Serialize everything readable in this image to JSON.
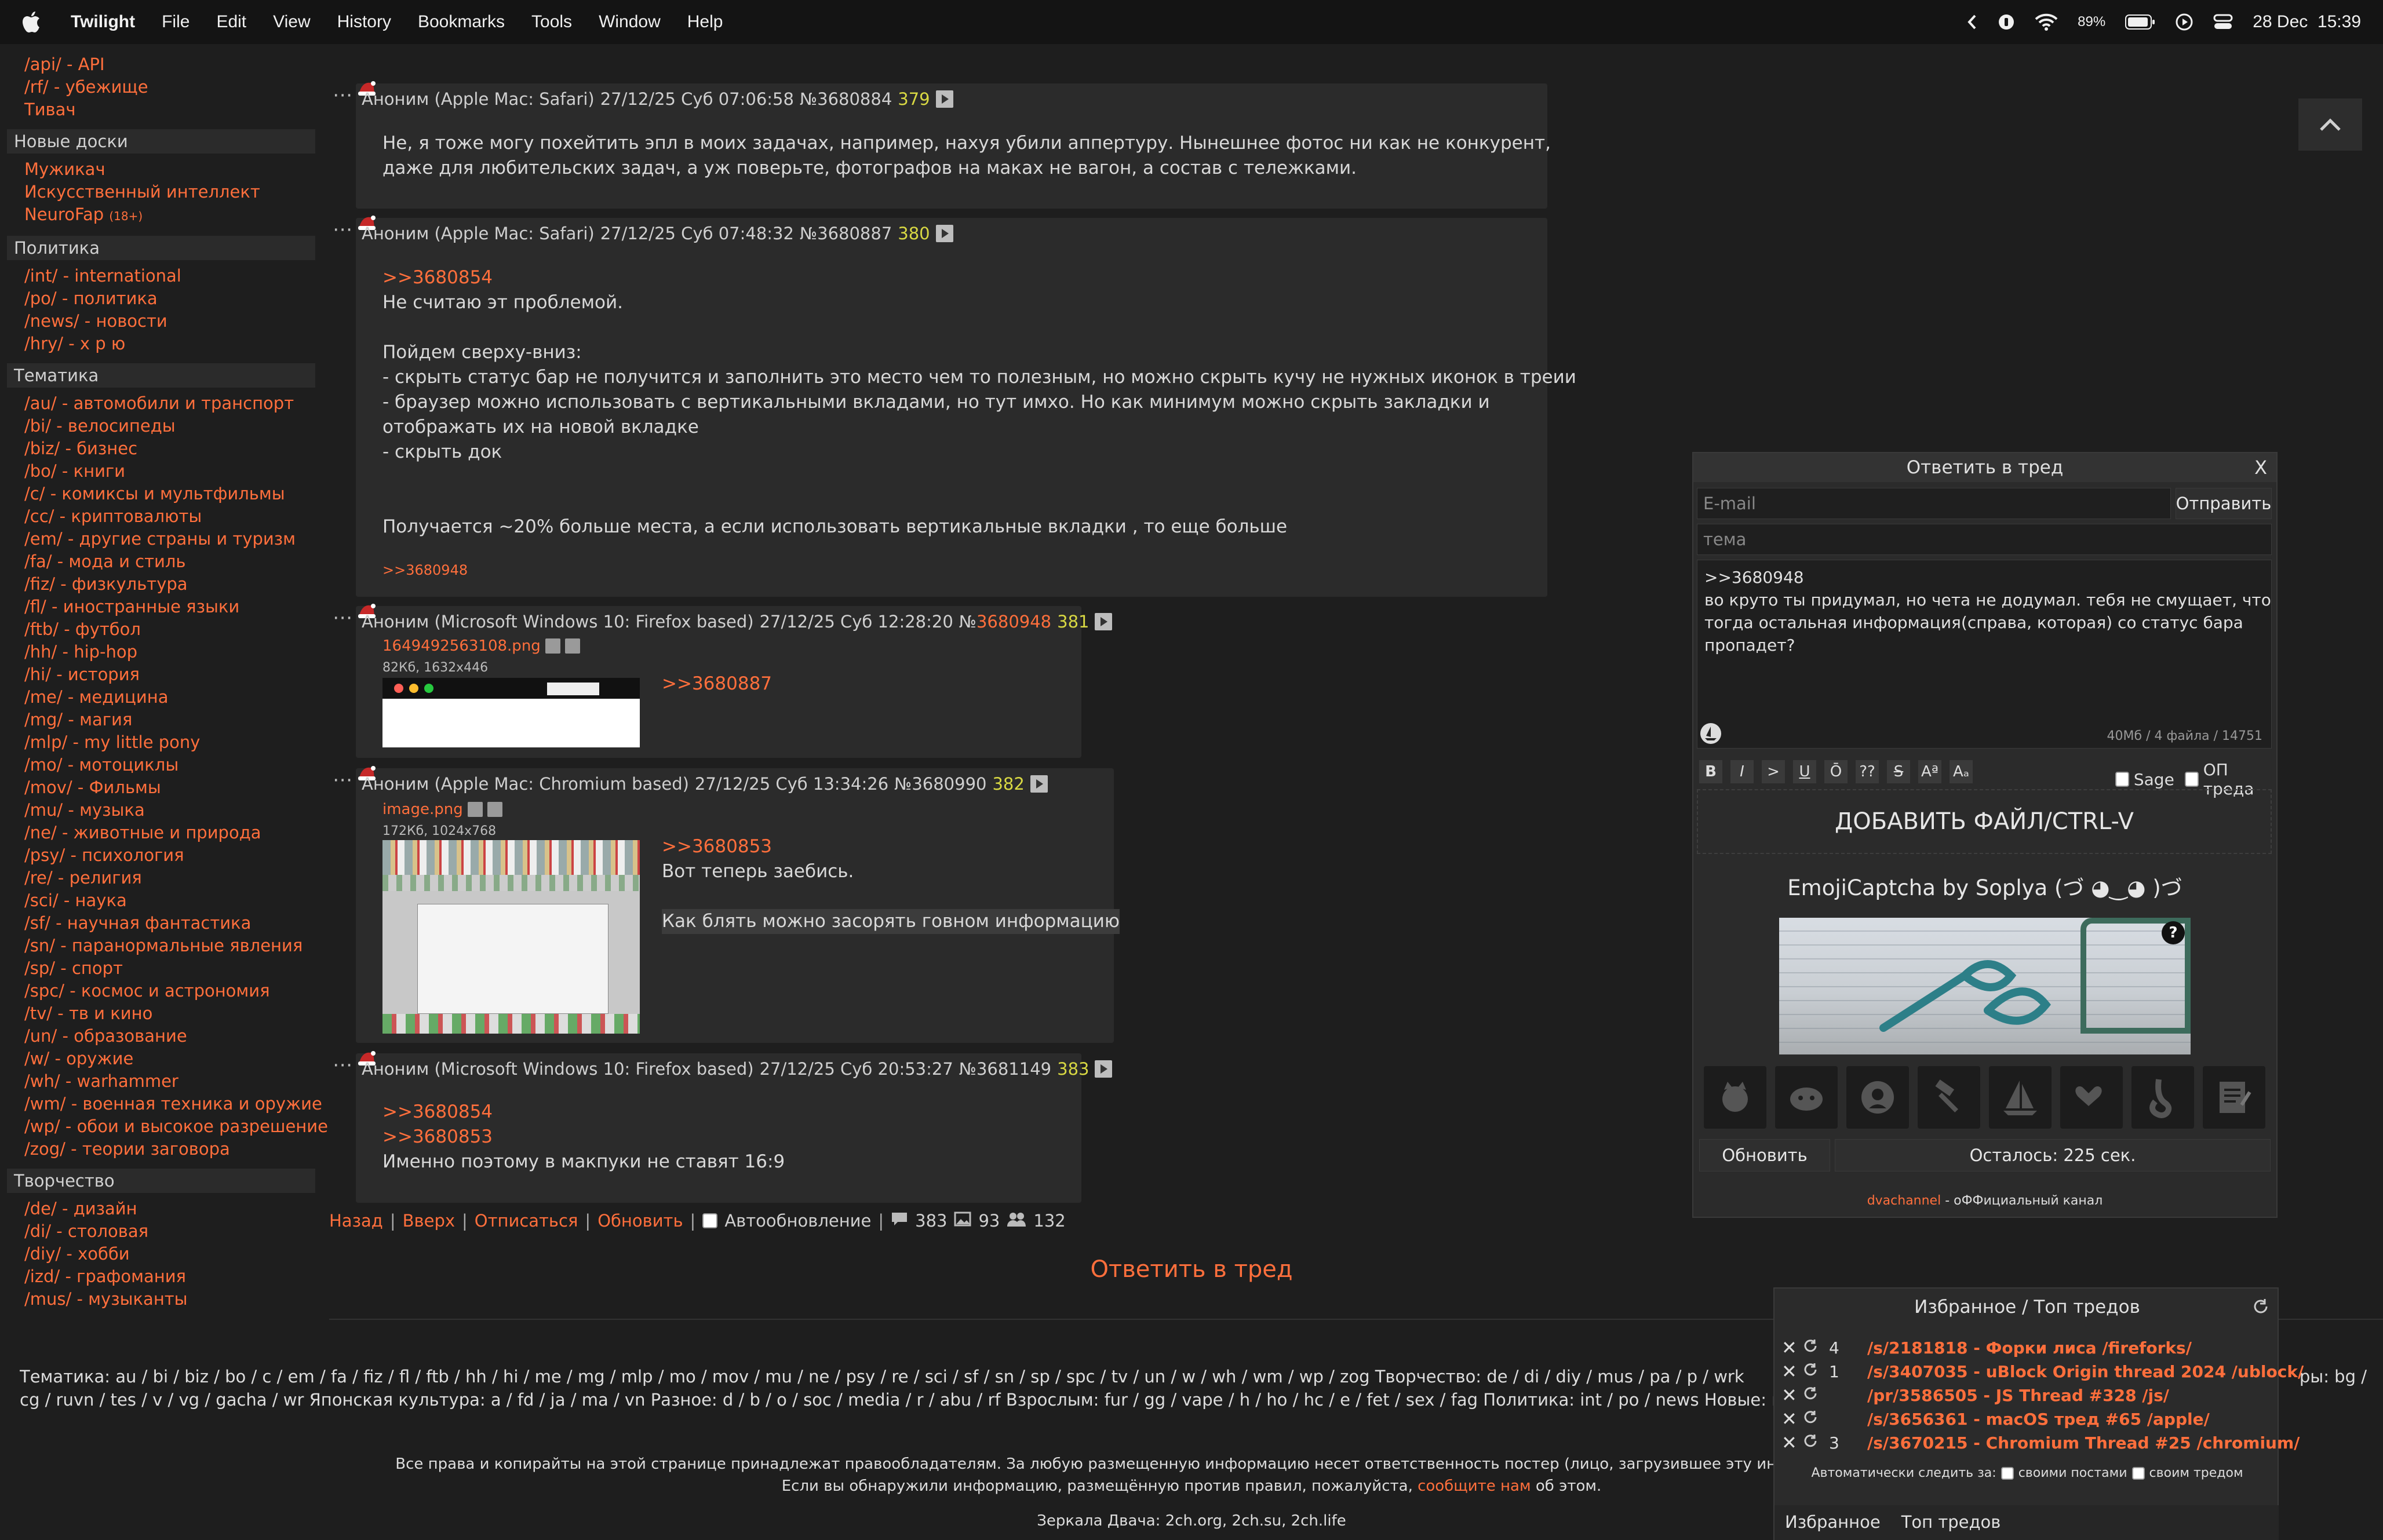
{
  "menubar": {
    "app_name": "Twilight",
    "menus": [
      "File",
      "Edit",
      "View",
      "History",
      "Bookmarks",
      "Tools",
      "Window",
      "Help"
    ],
    "battery": "89%",
    "datetime": "28 Dec  15:39"
  },
  "sidebar": {
    "top_items": [
      "/api/ - API",
      "/rf/ - убежище",
      "Тивач"
    ],
    "sections": [
      {
        "title": "Новые доски",
        "items": [
          {
            "label": "Мужикач"
          },
          {
            "label": "Искусственный интеллект"
          },
          {
            "label": "NeuroFap",
            "tag": "(18+)"
          }
        ]
      },
      {
        "title": "Политика",
        "items": [
          {
            "label": "/int/ - international"
          },
          {
            "label": "/po/ - политика"
          },
          {
            "label": "/news/ - новости"
          },
          {
            "label": "/hry/ - х р ю"
          }
        ]
      },
      {
        "title": "Тематика",
        "items": [
          {
            "label": "/au/ - автомобили и транспорт"
          },
          {
            "label": "/bi/ - велосипеды"
          },
          {
            "label": "/biz/ - бизнес"
          },
          {
            "label": "/bo/ - книги"
          },
          {
            "label": "/c/ - комиксы и мультфильмы"
          },
          {
            "label": "/cc/ - криптовалюты"
          },
          {
            "label": "/em/ - другие страны и туризм"
          },
          {
            "label": "/fa/ - мода и стиль"
          },
          {
            "label": "/fiz/ - физкультура"
          },
          {
            "label": "/fl/ - иностранные языки"
          },
          {
            "label": "/ftb/ - футбол"
          },
          {
            "label": "/hh/ - hip-hop"
          },
          {
            "label": "/hi/ - история"
          },
          {
            "label": "/me/ - медицина"
          },
          {
            "label": "/mg/ - магия"
          },
          {
            "label": "/mlp/ - my little pony"
          },
          {
            "label": "/mo/ - мотоциклы"
          },
          {
            "label": "/mov/ - Фильмы"
          },
          {
            "label": "/mu/ - музыка"
          },
          {
            "label": "/ne/ - животные и природа"
          },
          {
            "label": "/psy/ - психология"
          },
          {
            "label": "/re/ - религия"
          },
          {
            "label": "/sci/ - наука"
          },
          {
            "label": "/sf/ - научная фантастика"
          },
          {
            "label": "/sn/ - паранормальные явления"
          },
          {
            "label": "/sp/ - спорт"
          },
          {
            "label": "/spc/ - космос и астрономия"
          },
          {
            "label": "/tv/ - тв и кино"
          },
          {
            "label": "/un/ - образование"
          },
          {
            "label": "/w/ - оружие"
          },
          {
            "label": "/wh/ - warhammer"
          },
          {
            "label": "/wm/ - военная техника и оружие"
          },
          {
            "label": "/wp/ - обои и высокое разрешение"
          },
          {
            "label": "/zog/ - теории заговора"
          }
        ]
      },
      {
        "title": "Творчество",
        "items": [
          {
            "label": "/de/ - дизайн"
          },
          {
            "label": "/di/ - столовая"
          },
          {
            "label": "/diy/ - хобби"
          },
          {
            "label": "/izd/ - графомания"
          },
          {
            "label": "/mus/ - музыканты"
          }
        ]
      }
    ]
  },
  "posts": [
    {
      "author": "Аноним (Apple Mac: Safari)",
      "date": "27/12/25 Суб 07:06:58",
      "num": "№3680884",
      "count": "379",
      "lines": [
        "Не, я тоже могу похейтить эпл в моих задачах, например, нахуя убили аппертуру. Нынешнее фотос ни как не конкурент,",
        "даже для любительских задач, а уж поверьте, фотографов на маках не вагон, а состав с тележками."
      ]
    },
    {
      "author": "Аноним (Apple Mac: Safari)",
      "date": "27/12/25 Суб 07:48:32",
      "num": "№3680887",
      "count": "380",
      "reply_link": ">>3680854",
      "lines": [
        "Не считаю эт проблемой.",
        "",
        "Пойдем сверху-вниз:",
        "- скрыть статус бар не получится и заполнить это место чем то полезным, но можно скрыть кучу не нужных иконок в треии",
        "- браузер можно использовать с вертикальными вкладами, но тут имхо. Но как минимум можно скрыть закладки и",
        "отображать их на новой вкладке",
        "- скрыть док",
        "",
        "",
        "Получается ~20% больше места, а если использовать вертикальные вкладки , то еще больше"
      ],
      "backlink": ">>3680948"
    },
    {
      "author": "Аноним (Microsoft Windows 10: Firefox based)",
      "date": "27/12/25 Суб 12:28:20",
      "num_prefix": "№",
      "num": "3680948",
      "count": "381",
      "file_name": "1649492563108.png",
      "file_meta": "82Кб, 1632x446",
      "reply_link": ">>3680887"
    },
    {
      "author": "Аноним (Apple Mac: Chromium based)",
      "date": "27/12/25 Суб 13:34:26",
      "num": "№3680990",
      "count": "382",
      "file_name": "image.png",
      "file_meta": "172Кб, 1024x768",
      "reply_link": ">>3680853",
      "lines": [
        "Вот теперь заебись."
      ],
      "quote": "Как блять можно засорять говном информацию"
    },
    {
      "author": "Аноним (Microsoft Windows 10: Firefox based)",
      "date": "27/12/25 Суб 20:53:27",
      "num": "№3681149",
      "count": "383",
      "reply_links": [
        ">>3680854",
        ">>3680853"
      ],
      "lines": [
        "Именно поэтому в макпуки не ставят 16:9"
      ]
    }
  ],
  "thread_nav": {
    "back": "Назад",
    "top": "Вверх",
    "unsubscribe": "Отписаться",
    "refresh": "Обновить",
    "autorefresh": "Автообновление",
    "posts_count": "383",
    "files_count": "93",
    "users_count": "132"
  },
  "reply_center": "Ответить в тред",
  "reply_form": {
    "title": "Ответить в тред",
    "close": "X",
    "email_placeholder": "E-mail",
    "send": "Отправить",
    "subject_placeholder": "тема",
    "text": ">>3680948\nво круто ты придумал, но чета не додумал. тебя не смущает, что\nтогда остальная информация(справа, которая) со статус бара\nпропадет?",
    "limits": "40Мб / 4 файла / 14751",
    "format_buttons": [
      "B",
      "I",
      ">",
      "U",
      "Ō",
      "??",
      "S",
      "Aª",
      "Aₐ"
    ],
    "sage": "Sage",
    "op": "ОП треда",
    "add_file": "ДОБАВИТЬ ФАЙЛ/CTRL-V",
    "captcha_title": "EmojiCaptcha by Soplya (づ ◕‿◕ )づ",
    "captcha_help": "?",
    "captcha_emojis": [
      "cat-icon",
      "face-icon",
      "gamepad-icon",
      "hammer-icon",
      "sailboat-icon",
      "hearts-icon",
      "leg-icon",
      "memo-icon"
    ],
    "refresh": "Обновить",
    "remaining": "Осталось: 225 сек.",
    "channel_link": "dvachannel",
    "channel_text": " - оФФициальный канал"
  },
  "favorites": {
    "title": "Избранное / Топ тредов",
    "rows": [
      {
        "count": "4",
        "label": "/s/2181818 - Форки лиса /fireforks/"
      },
      {
        "count": "1",
        "label": "/s/3407035 - uBlock Origin thread 2024 /ublock/"
      },
      {
        "count": "",
        "label": "/pr/3586505 - JS Thread #328 /js/"
      },
      {
        "count": "",
        "label": "/s/3656361 - macOS тред #65 /apple/"
      },
      {
        "count": "3",
        "label": "/s/3670215 - Chromium Thread #25 /chromium/"
      }
    ],
    "autofollow_label": "Автоматически следить за:",
    "own_posts": "своими постами",
    "own_thread": "своим тредом",
    "tab_favorites": "Избранное",
    "tab_top": "Топ тредов"
  },
  "footer": {
    "line1": "Тематика: au / bi / biz / bo / c / em / fa / fiz / fl / ftb / hh / hi / me / mg / mlp / mo / mov / mu / ne / psy / re / sci / sf / sn / sp / spc / tv / un / w / wh / wm / wp / zog Творчество: de / di / diy / mus / pa / p / wrk",
    "line1_tail": "ры: bg /",
    "line2": "cg / ruvn / tes / v / vg / gacha / wr Японская культура: a / fd / ja / ma / vn Разное: d / b / o / soc / media / r / abu / rf Взрослым: fur / gg / vape / h / ho / hc / e / fet / sex / fag Политика: int / po / news Новые: ma",
    "copyright1": "Все права и копирайты на этой странице принадлежат правообладателям. За любую размещенную информацию несет ответственность постер (лицо, загрузившее эту информацию). Все коммента",
    "copyright2_pre": "Если вы обнаружили информацию, размещённую против правил, пожалуйста, ",
    "copyright2_link": "сообщите нам",
    "copyright2_post": " об этом.",
    "mirrors": "Зеркала Двача: 2ch.org, 2ch.su, 2ch.life"
  }
}
